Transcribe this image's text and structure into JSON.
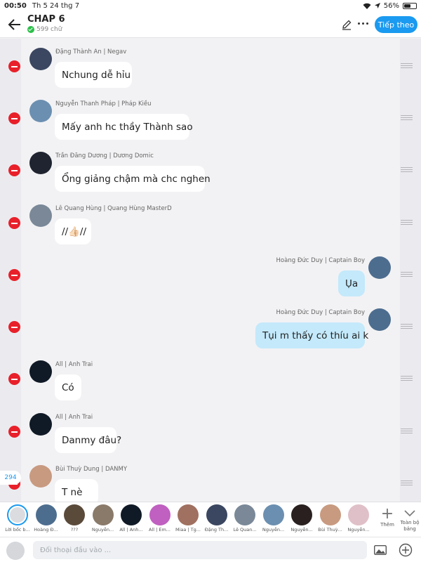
{
  "status": {
    "time": "00:50",
    "date": "Th 5 24 thg 7",
    "battery": "56%",
    "battery_level": 0.56
  },
  "header": {
    "title": "CHAP 6",
    "word_count": "599 chữ",
    "follow_label": "Tiếp theo"
  },
  "messages": [
    {
      "sender": "Đặng Thành An | Negav",
      "text": "Nchung dễ hỉu",
      "side": "left",
      "avatar_color": "#3b4660"
    },
    {
      "sender": "Nguyễn Thanh Pháp | Pháp Kiều",
      "text": "Mấy anh hc thầy Thành sao",
      "side": "left",
      "avatar_color": "#6b8fb0"
    },
    {
      "sender": "Trần Đăng Dương | Dương Domic",
      "text": "Ổng giảng chậm mà chc nghen",
      "side": "left",
      "avatar_color": "#1f2430"
    },
    {
      "sender": "Lê Quang Hùng | Quang Hùng MasterD",
      "text": "//👍🏻//",
      "side": "left",
      "avatar_color": "#7a8898"
    },
    {
      "sender": "Hoàng Đức Duy | Captain Boy",
      "text": "Ụa",
      "side": "right",
      "avatar_color": "#4d6d8f"
    },
    {
      "sender": "Hoàng Đức Duy | Captain Boy",
      "text": "Tụi m thấy có thíu ai k",
      "side": "right",
      "avatar_color": "#4d6d8f"
    },
    {
      "sender": "All | Anh Trai",
      "text": "Có",
      "side": "left",
      "avatar_color": "#101a26"
    },
    {
      "sender": "All | Anh Trai",
      "text": "Danmy đâu?",
      "side": "left",
      "avatar_color": "#101a26"
    },
    {
      "sender": "Bùi Thuỳ Dung | DANMY",
      "text": "T nè",
      "side": "left",
      "avatar_color": "#c89a80"
    }
  ],
  "scroll_count": "294",
  "characters": [
    {
      "label": "Lời bốc b...",
      "color": "#dadce0"
    },
    {
      "label": "Hoàng Đ...",
      "color": "#4d6d8f"
    },
    {
      "label": "???",
      "color": "#5a4a3a"
    },
    {
      "label": "Nguyễn...",
      "color": "#8a7a6a"
    },
    {
      "label": "All | Anh...",
      "color": "#101a26"
    },
    {
      "label": "All | Em...",
      "color": "#c060c0"
    },
    {
      "label": "Miaa | Tg...",
      "color": "#a07060"
    },
    {
      "label": "Đặng Th...",
      "color": "#3b4660"
    },
    {
      "label": "Lê Quan...",
      "color": "#7a8898"
    },
    {
      "label": "Nguyễn...",
      "color": "#6b8fb0"
    },
    {
      "label": "Nguyễn...",
      "color": "#2a2020"
    },
    {
      "label": "Bùi Thuỳ...",
      "color": "#c89a80"
    },
    {
      "label": "Nguyễn...",
      "color": "#e0c0c8"
    }
  ],
  "add_label": "Thêm",
  "all_label": "Toàn bộ bảng",
  "composer": {
    "placeholder": "Đối thoại đầu vào ..."
  }
}
